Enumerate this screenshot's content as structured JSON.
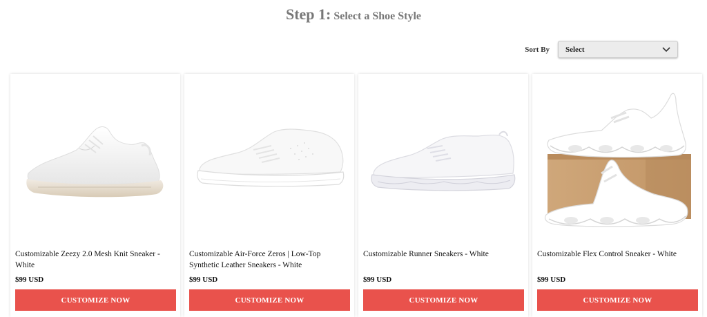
{
  "header": {
    "step": "Step 1:",
    "subtitle": "Select a Shoe Style"
  },
  "sort": {
    "label": "Sort By",
    "selected": "Select"
  },
  "colors": {
    "accent": "#e9524c",
    "title_gray": "#777777"
  },
  "products": [
    {
      "title": "Customizable Zeezy 2.0 Mesh Knit Sneaker - White",
      "price": "$99 USD",
      "button": "CUSTOMIZE NOW",
      "image": "knit-sneaker-image"
    },
    {
      "title": "Customizable Air-Force Zeros | Low-Top Synthetic Leather Sneakers - White",
      "price": "$99 USD",
      "button": "CUSTOMIZE NOW",
      "image": "low-top-sneaker-image"
    },
    {
      "title": "Customizable Runner Sneakers - White",
      "price": "$99 USD",
      "button": "CUSTOMIZE NOW",
      "image": "runner-sneaker-image"
    },
    {
      "title": "Customizable Flex Control Sneaker - White",
      "price": "$99 USD",
      "button": "CUSTOMIZE NOW",
      "image": "flex-sneaker-with-box-image"
    }
  ]
}
